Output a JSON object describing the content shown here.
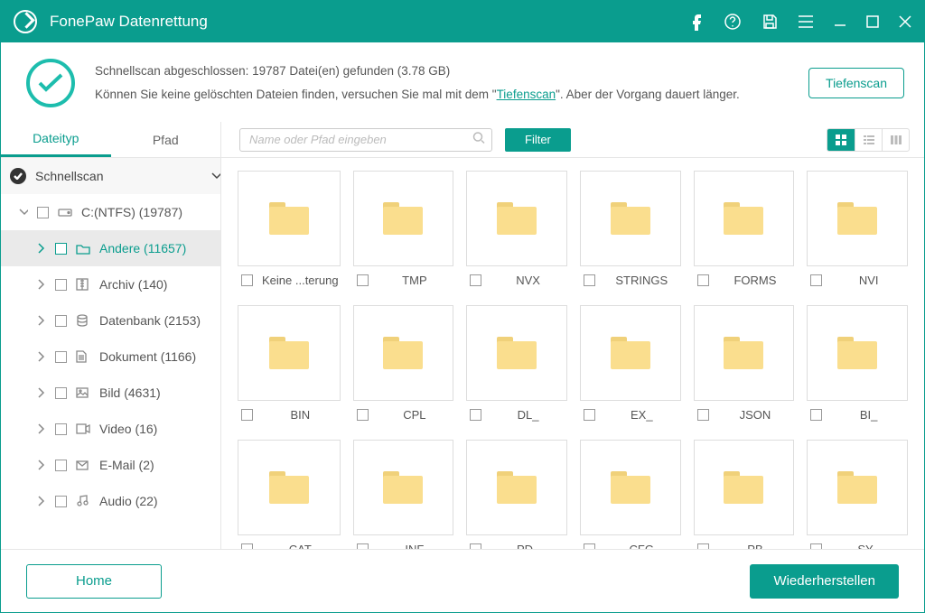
{
  "app_title": "FonePaw Datenrettung",
  "titlebar_icons": [
    "facebook",
    "help",
    "save",
    "menu",
    "minimize",
    "maximize",
    "close"
  ],
  "notice": {
    "line1": "Schnellscan abgeschlossen: 19787 Datei(en) gefunden (3.78 GB)",
    "line2_pre": "Können Sie keine gelöschten Dateien finden, versuchen Sie mal mit dem \"",
    "deep_link": "Tiefenscan",
    "line2_post": "\". Aber der Vorgang dauert länger.",
    "deepscan_button": "Tiefenscan"
  },
  "tabs": {
    "filetype": "Dateityp",
    "path": "Pfad"
  },
  "search_placeholder": "Name oder Pfad eingeben",
  "filter_label": "Filter",
  "tree": {
    "schnellscan": "Schnellscan",
    "drive": "C:(NTFS) (19787)",
    "cats": [
      {
        "label": "Andere (11657)",
        "icon": "folder",
        "selected": true
      },
      {
        "label": "Archiv (140)",
        "icon": "archive"
      },
      {
        "label": "Datenbank (2153)",
        "icon": "database"
      },
      {
        "label": "Dokument (1166)",
        "icon": "document"
      },
      {
        "label": "Bild (4631)",
        "icon": "image"
      },
      {
        "label": "Video (16)",
        "icon": "video"
      },
      {
        "label": "E-Mail (2)",
        "icon": "email"
      },
      {
        "label": "Audio (22)",
        "icon": "audio"
      }
    ]
  },
  "folders": [
    "Keine ...terung",
    "TMP",
    "NVX",
    "STRINGS",
    "FORMS",
    "NVI",
    "BIN",
    "CPL",
    "DL_",
    "EX_",
    "JSON",
    "BI_",
    "CAT",
    "INF",
    "PD_",
    "CFG",
    "PB",
    "SY_"
  ],
  "footer": {
    "home": "Home",
    "recover": "Wiederherstellen"
  },
  "colors": {
    "accent": "#0a9d8e"
  }
}
